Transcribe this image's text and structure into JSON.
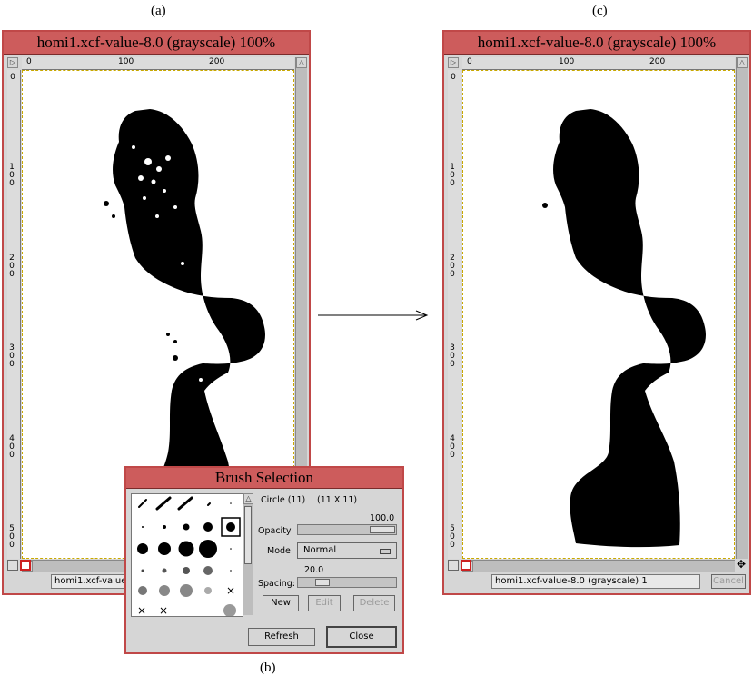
{
  "captions": {
    "a": "(a)",
    "b": "(b)",
    "c": "(c)"
  },
  "window_a": {
    "title": "homi1.xcf-value-8.0 (grayscale) 100%",
    "ruler_h": [
      "0",
      "100",
      "200"
    ],
    "ruler_v": [
      "0",
      "100",
      "200",
      "300",
      "400",
      "500"
    ],
    "status": "homi1.xcf-value-"
  },
  "window_c": {
    "title": "homi1.xcf-value-8.0 (grayscale) 100%",
    "ruler_h": [
      "0",
      "100",
      "200"
    ],
    "ruler_v": [
      "0",
      "100",
      "200",
      "300",
      "400",
      "500"
    ],
    "status": "homi1.xcf-value-8.0 (grayscale) 1",
    "cancel_label": "Cancel"
  },
  "brush_dialog": {
    "title": "Brush Selection",
    "brush_name": "Circle (11)",
    "brush_size": "(11 X 11)",
    "opacity_label": "Opacity:",
    "opacity_value": "100.0",
    "opacity_fraction": 1.0,
    "mode_label": "Mode:",
    "mode_value": "Normal",
    "spacing_label": "Spacing:",
    "spacing_value": "20.0",
    "spacing_fraction": 0.2,
    "new_label": "New",
    "edit_label": "Edit",
    "delete_label": "Delete",
    "refresh_label": "Refresh",
    "close_label": "Close"
  },
  "colors": {
    "frame": "#cd5c5c",
    "border": "#c04848",
    "panel": "#d6d6d6"
  }
}
